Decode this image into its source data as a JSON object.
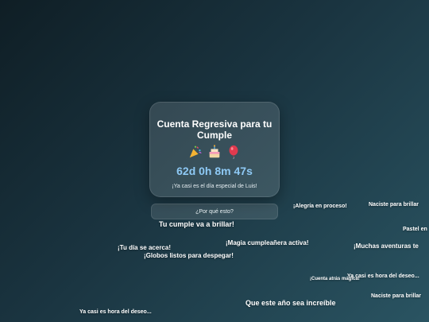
{
  "card": {
    "title": "Cuenta Regresiva para tu Cumple",
    "emojis": [
      "party-popper-icon",
      "birthday-cake-icon",
      "balloon-icon"
    ],
    "countdown": "62d 0h 8m 47s",
    "subtitle": "¡Ya casi es el día especial de Luis!"
  },
  "why_button": {
    "label": "¿Por qué esto?"
  },
  "floating_messages": [
    "Tu cumple va a brillar!",
    "¡Tu día se acerca!",
    "¡Globos listos para despegar!",
    "¡Magia cumpleañera activa!",
    "¡Alegría en proceso!",
    "Naciste para brillar",
    "Pastel en",
    "¡Muchas aventuras te",
    "Ya casi es hora del deseo...",
    "¡Cuenta atrás mágica!",
    "Que este año sea increíble",
    "Naciste para brillar",
    "Ya casi es hora del deseo..."
  ],
  "colors": {
    "countdown": "#8ec9f5",
    "background_start": "#0f1e25",
    "background_end": "#2a5462"
  }
}
